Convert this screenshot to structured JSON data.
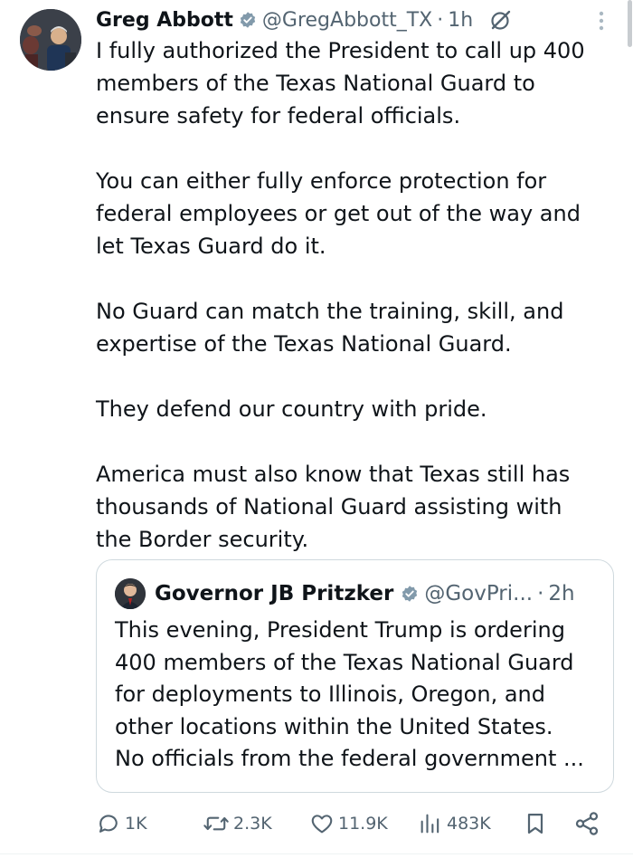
{
  "tweet": {
    "author": {
      "name": "Greg Abbott",
      "handle": "@GregAbbott_TX",
      "separator": "·",
      "time": "1h",
      "avatar_icon": "profile-photo-icon"
    },
    "paragraphs": [
      [
        "I fully authorized the President to call up 400",
        "members of the Texas National Guard to",
        "ensure safety for federal officials."
      ],
      [
        "You can either fully enforce protection for",
        "federal employees or get out of the way and",
        "let Texas Guard do it."
      ],
      [
        "No Guard can match the training, skill, and",
        "expertise of the Texas National Guard."
      ],
      [
        "They defend our country with pride."
      ],
      [
        "America must also know that Texas still has",
        "thousands of National Guard assisting with",
        "the Border security."
      ]
    ]
  },
  "quoted_tweet": {
    "author": {
      "name": "Governor JB Pritzker",
      "handle": "@GovPri...",
      "separator": "·",
      "time": "2h"
    },
    "lines": [
      "This evening, President Trump is ordering",
      "400 members of the Texas National Guard",
      "for deployments to Illinois, Oregon, and",
      "other locations within the United States.",
      "No officials from the federal government ..."
    ]
  },
  "actions": {
    "replies": "1K",
    "reposts": "2.3K",
    "likes": "11.9K",
    "views": "483K"
  },
  "colors": {
    "text": "#0f1419",
    "secondary": "#536471",
    "border": "#cfd9de",
    "verified_badge": "#829aab"
  },
  "icons": {
    "verified": "verified-badge-icon",
    "grok": "grok-icon",
    "more": "more-options-icon",
    "reply": "reply-icon",
    "repost": "repost-icon",
    "like": "heart-icon",
    "views": "views-chart-icon",
    "bookmark": "bookmark-icon",
    "share": "share-icon"
  }
}
